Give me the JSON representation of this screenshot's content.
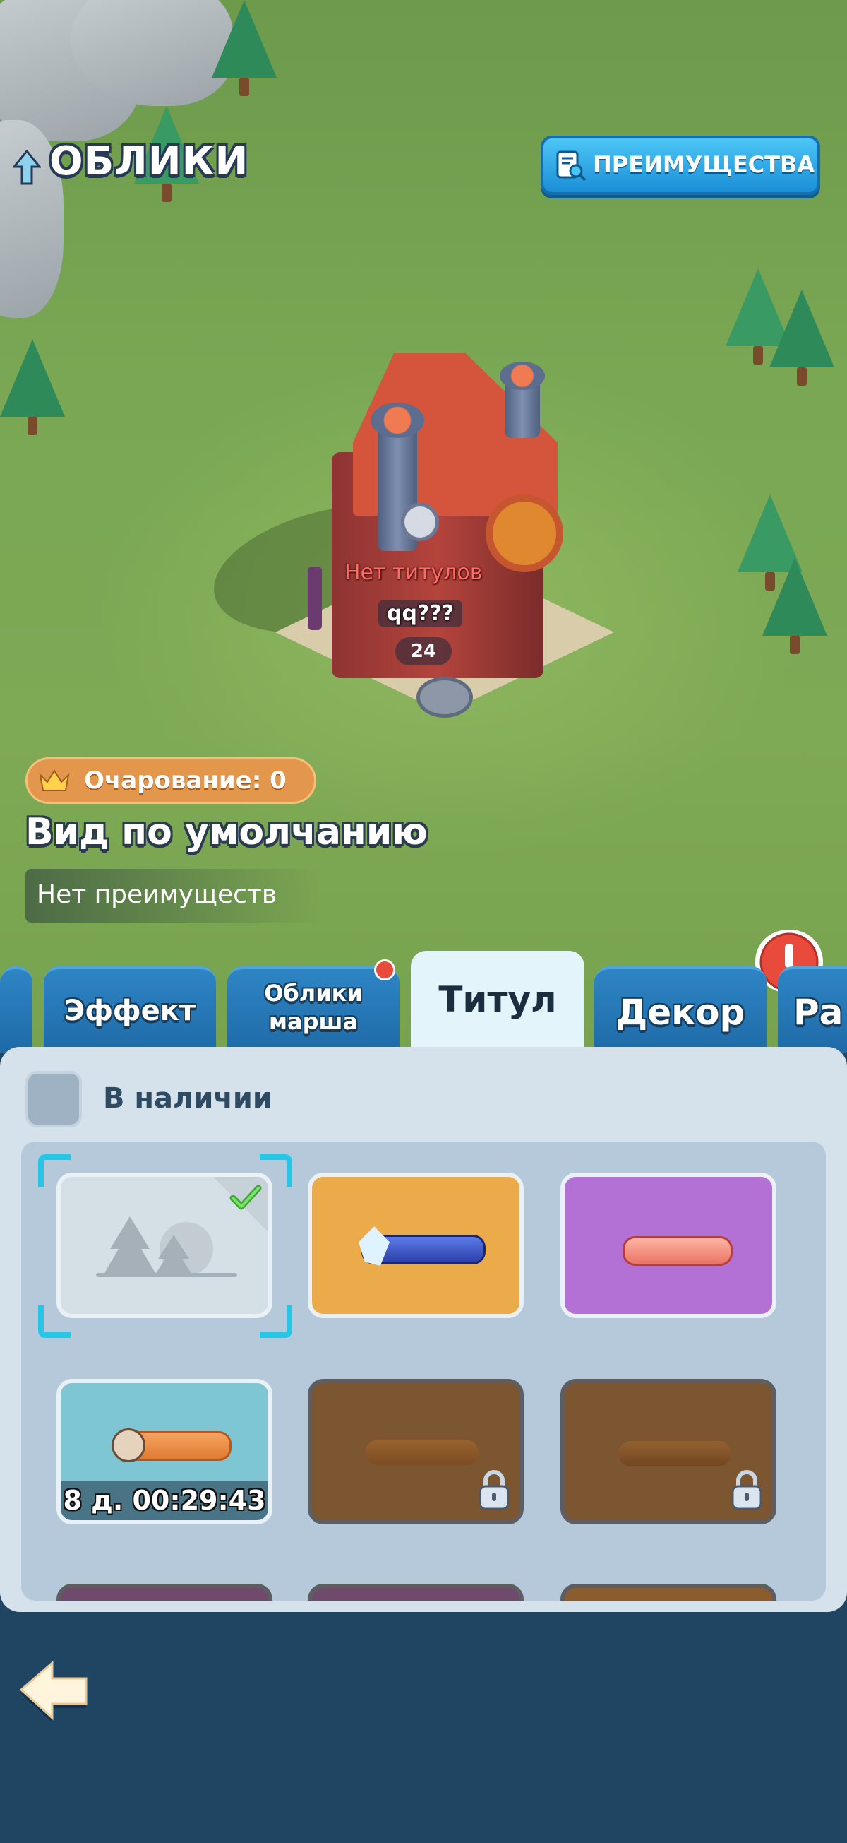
{
  "header": {
    "title": "ОБЛИКИ",
    "benefits_button": "ПРЕИМУЩЕСТВА"
  },
  "building": {
    "no_titles": "Нет титулов",
    "player_name": "qq???",
    "level": "24"
  },
  "info": {
    "charm_label": "Очарование: 0",
    "skin_name": "Вид по умолчанию",
    "benefits_text": "Нет преимуществ"
  },
  "tabs": [
    {
      "label": "Эффект",
      "active": false
    },
    {
      "label": "Облики\nмарша",
      "active": false,
      "badge": true
    },
    {
      "label": "Титул",
      "active": true
    },
    {
      "label": "Декор",
      "active": false
    },
    {
      "label": "Ра",
      "active": false
    }
  ],
  "filter": {
    "available_label": "В наличии",
    "checked": false
  },
  "cards": [
    {
      "kind": "default",
      "bg": "#d5e0e6",
      "selected": true,
      "equipped": true
    },
    {
      "kind": "ribbon",
      "bg": "#ebab4b",
      "ribbon": "blue"
    },
    {
      "kind": "ribbon",
      "bg": "#b371d5",
      "ribbon": "pink"
    },
    {
      "kind": "ribbon",
      "bg": "#7ec6d4",
      "ribbon": "orange",
      "timer": "8 д. 00:29:43"
    },
    {
      "kind": "ribbon",
      "bg": "#7b5630",
      "ribbon": "brown",
      "locked": true
    },
    {
      "kind": "ribbon",
      "bg": "#7b5630",
      "ribbon": "brown",
      "locked": true
    }
  ],
  "colors": {
    "accent_blue": "#1b8ed7",
    "panel": "#d5e2ec",
    "bottom_bar": "#1f4563",
    "alert_red": "#e84a3b",
    "charm_orange": "#e3974c"
  },
  "icons": {
    "header": "up-arrow-icon",
    "benefits": "document-search-icon",
    "charm": "crown-icon",
    "alert": "exclamation-speech-icon",
    "back": "back-arrow-icon",
    "equipped": "checkmark-icon",
    "lock": "padlock-icon"
  }
}
